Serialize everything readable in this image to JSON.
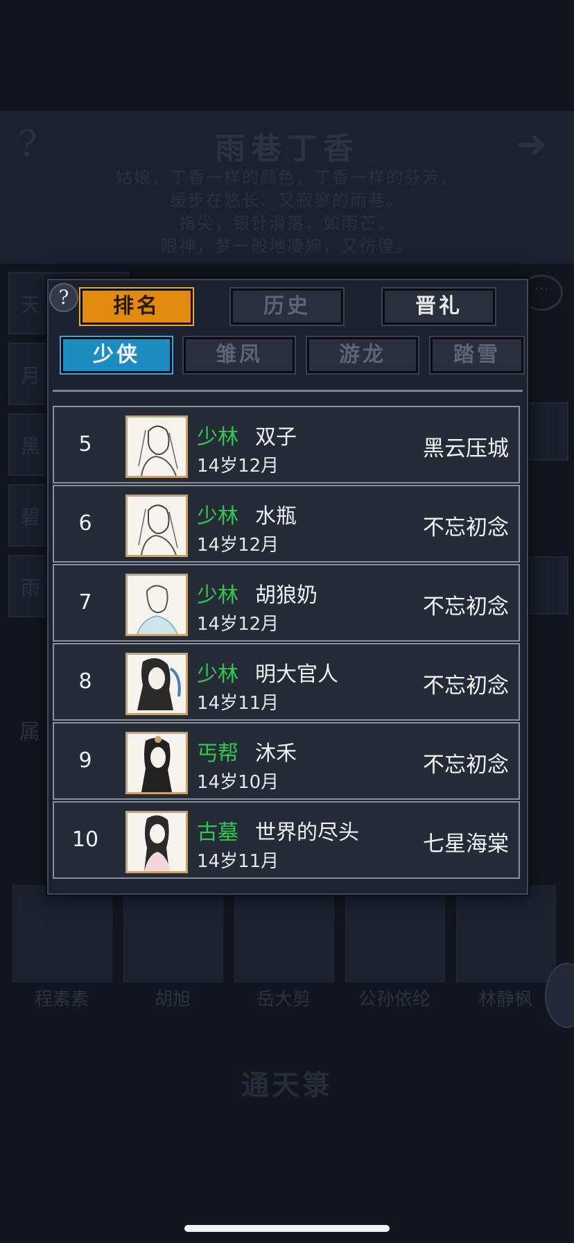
{
  "background": {
    "help_glyph": "?",
    "arrow_glyph": "➜",
    "event_title": "雨巷丁香",
    "poem_lines": [
      "姑娘，丁香一样的颜色，丁香一样的芬芳，",
      "缓步在悠长、又寂寥的雨巷。",
      "指尖，银针滑落，如雨芒。",
      "眼神，梦一般地凄婉，又彷徨。"
    ],
    "side_items": [
      "天",
      "月",
      "黑",
      "碧",
      "雨"
    ],
    "attr_label": "属",
    "portrait_names": [
      "程素素",
      "胡旭",
      "岳大剪",
      "公孙依纶",
      "林静枫"
    ],
    "bottom_title": "通天箓"
  },
  "modal": {
    "help_glyph": "?",
    "main_tabs": [
      {
        "label": "排名",
        "state": "active"
      },
      {
        "label": "历史",
        "state": "inactive"
      },
      {
        "label": "晋礼",
        "state": "white"
      }
    ],
    "sub_tabs": [
      {
        "label": "少侠",
        "state": "active"
      },
      {
        "label": "雏凤",
        "state": "inactive"
      },
      {
        "label": "游龙",
        "state": "inactive"
      },
      {
        "label": "踏雪",
        "state": "inactive"
      }
    ],
    "rows": [
      {
        "rank": "5",
        "sect": "少林",
        "name": "双子",
        "age": "14岁12月",
        "title": "黑云压城"
      },
      {
        "rank": "6",
        "sect": "少林",
        "name": "水瓶",
        "age": "14岁12月",
        "title": "不忘初念"
      },
      {
        "rank": "7",
        "sect": "少林",
        "name": "胡狼奶",
        "age": "14岁12月",
        "title": "不忘初念"
      },
      {
        "rank": "8",
        "sect": "少林",
        "name": "明大官人",
        "age": "14岁11月",
        "title": "不忘初念"
      },
      {
        "rank": "9",
        "sect": "丐帮",
        "name": "沐禾",
        "age": "14岁10月",
        "title": "不忘初念"
      },
      {
        "rank": "10",
        "sect": "古墓",
        "name": "世界的尽头",
        "age": "14岁11月",
        "title": "七星海棠"
      }
    ]
  },
  "colors": {
    "sect_green": "#32c84f",
    "tab_active_orange": "#e2890f",
    "subtab_active_blue": "#1d8cc0"
  }
}
